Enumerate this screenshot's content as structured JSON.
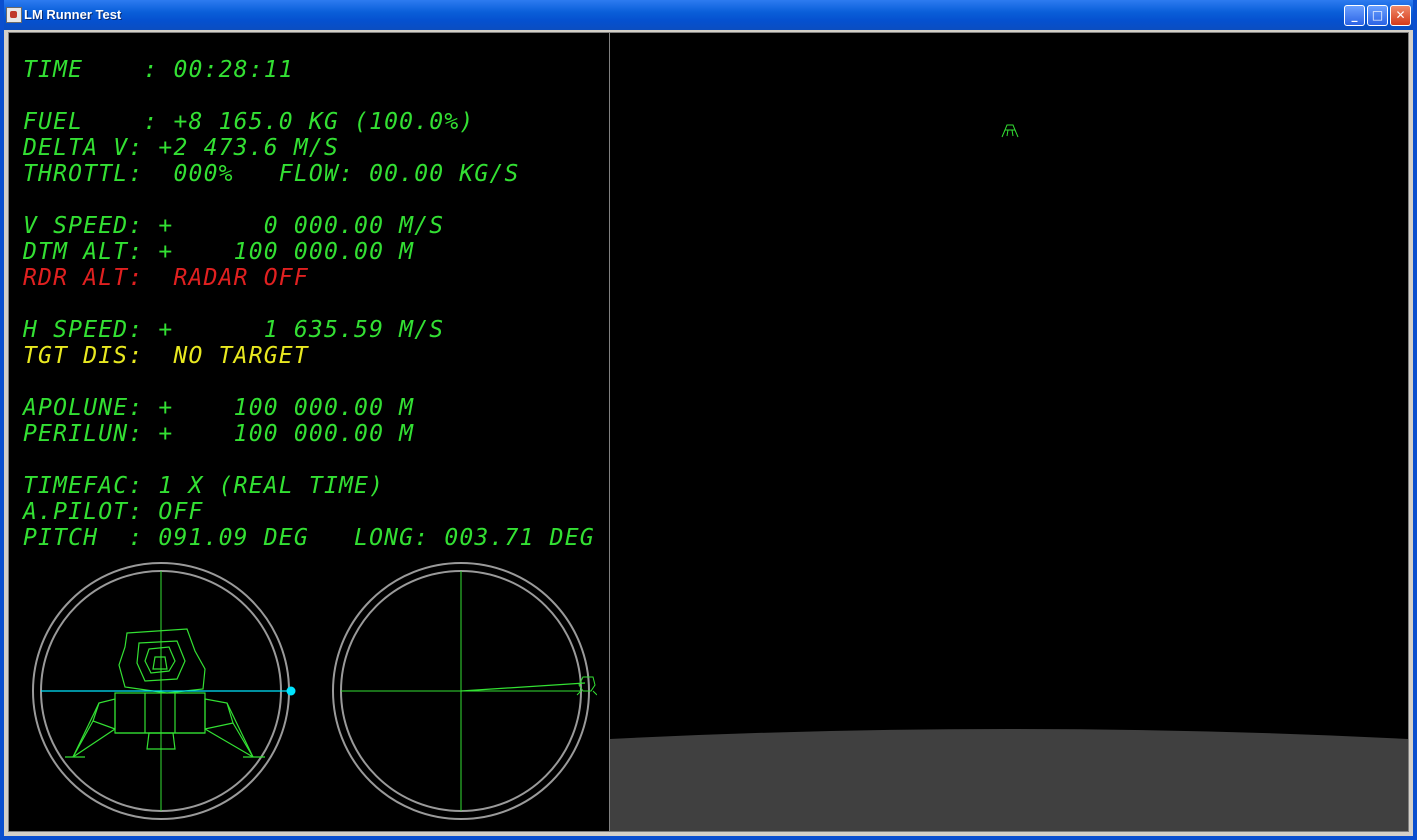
{
  "window": {
    "title": "LM Runner Test",
    "buttons": {
      "minimize": "_",
      "maximize": "□",
      "close": "✕"
    }
  },
  "hud": {
    "time": "TIME    : 00:28:11",
    "fuel": "FUEL    : +8 165.0 KG (100.0%)",
    "delta_v": "DELTA V: +2 473.6 M/S",
    "throttle": "THROTTL:  000%   FLOW: 00.00 KG/S",
    "v_speed": "V SPEED: +      0 000.00 M/S",
    "dtm_alt": "DTM ALT: +    100 000.00 M",
    "rdr_alt": "RDR ALT:  RADAR OFF",
    "h_speed": "H SPEED: +      1 635.59 M/S",
    "tgt_dis": "TGT DIS:  NO TARGET",
    "apolune": "APOLUNE: +    100 000.00 M",
    "perilun": "PERILUN: +    100 000.00 M",
    "timefac": "TIMEFAC: 1 X (REAL TIME)",
    "a_pilot": "A.PILOT: OFF",
    "pitch": "PITCH  : 091.09 DEG   LONG: 003.71 DEG"
  },
  "instruments": {
    "attitude_indicator": "lander-attitude",
    "longitude_indicator": "orbit-longitude"
  },
  "colors": {
    "hud_green": "#33e033",
    "warning_red": "#e02020",
    "caution_yellow": "#e8e820",
    "horizon_cyan": "#00e5ff",
    "lunar_surface": "#404040"
  }
}
